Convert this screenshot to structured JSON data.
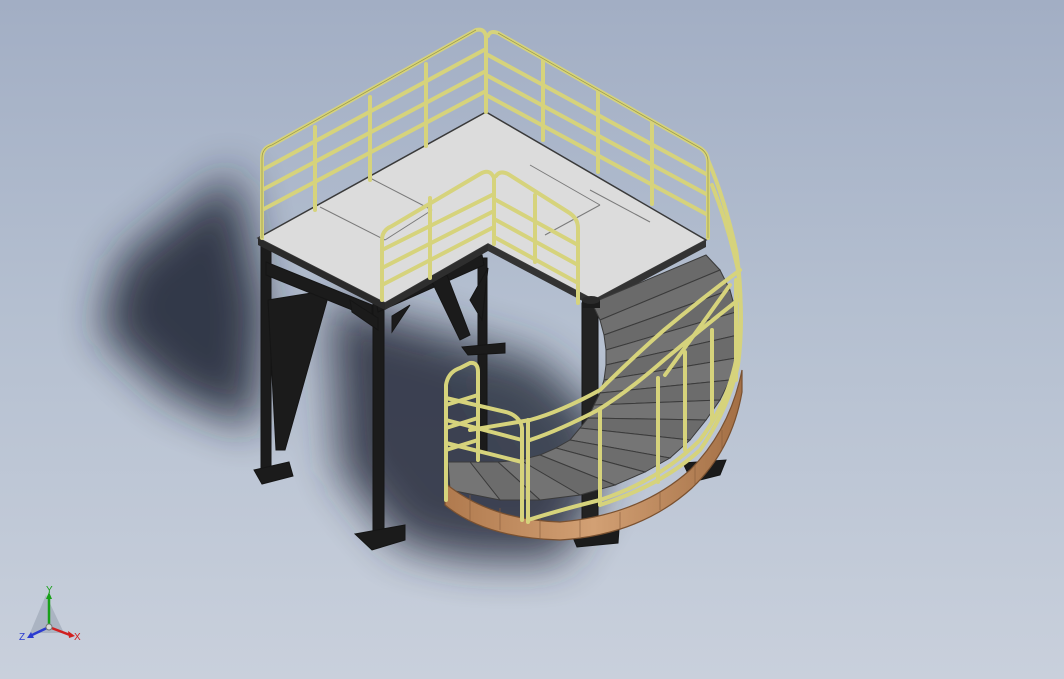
{
  "viewport": {
    "background_top": "#a2aec4",
    "background_bottom": "#c9d0dc"
  },
  "model": {
    "colors": {
      "railing": "#d6d37c",
      "railing_edge": "#8a8736",
      "deck": "#dedfdf",
      "frame": "#1b1b1b",
      "stair_tread": "#6d6d6d",
      "stair_stringer": "#c99366",
      "shadow": "#202632"
    }
  },
  "triad": {
    "icon": "coordinate-triad-icon",
    "y_label": "Y",
    "z_label": "Z",
    "x_label": "X",
    "y_color": "#18a018",
    "z_color": "#2b3bd0",
    "x_color": "#d02020"
  }
}
